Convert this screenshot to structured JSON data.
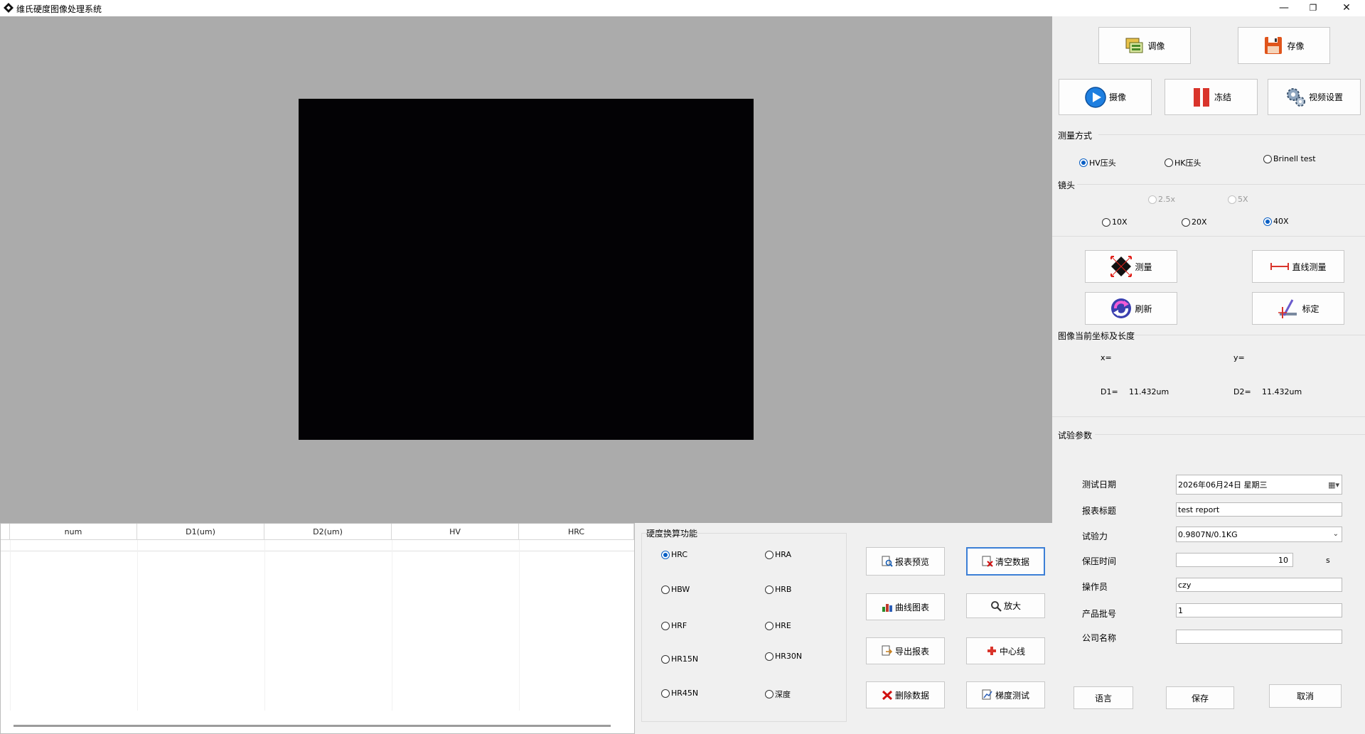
{
  "window": {
    "title": "维氏硬度图像处理系统",
    "minimize": "—",
    "restore": "❐",
    "close": "✕"
  },
  "table": {
    "columns": [
      "num",
      "D1(um)",
      "D2(um)",
      "HV",
      "HRC"
    ]
  },
  "conversion": {
    "title": "硬度换算功能",
    "options": [
      {
        "label": "HRC",
        "checked": true
      },
      {
        "label": "HRA",
        "checked": false
      },
      {
        "label": "HBW",
        "checked": false
      },
      {
        "label": "HRB",
        "checked": false
      },
      {
        "label": "HRF",
        "checked": false
      },
      {
        "label": "HRE",
        "checked": false
      },
      {
        "label": "HR15N",
        "checked": false
      },
      {
        "label": "HR30N",
        "checked": false
      },
      {
        "label": "HR45N",
        "checked": false
      },
      {
        "label": "深度",
        "checked": false
      }
    ]
  },
  "actions": {
    "report_preview": "报表预览",
    "clear_data": "清空数据",
    "curve_chart": "曲线图表",
    "zoom": "放大",
    "export_report": "导出报表",
    "center_line": "中心线",
    "delete_data": "删除数据",
    "gradient_test": "梯度测试"
  },
  "top_buttons": {
    "adjust": "调像",
    "save_image": "存像",
    "capture": "摄像",
    "freeze": "冻结",
    "video_settings": "视频设置"
  },
  "measure_mode": {
    "title": "测量方式",
    "options": [
      {
        "label": "HV压头",
        "checked": true
      },
      {
        "label": "HK压头",
        "checked": false
      },
      {
        "label": "Brinell test",
        "checked": false
      }
    ]
  },
  "lens": {
    "title": "镜头",
    "options": [
      {
        "label": "2.5x",
        "checked": false,
        "disabled": true
      },
      {
        "label": "5X",
        "checked": false,
        "disabled": true
      },
      {
        "label": "10X",
        "checked": false,
        "disabled": false
      },
      {
        "label": "20X",
        "checked": false,
        "disabled": false
      },
      {
        "label": "40X",
        "checked": true,
        "disabled": false
      }
    ]
  },
  "tools": {
    "measure": "测量",
    "line_measure": "直线测量",
    "refresh": "刷新",
    "calibrate": "标定"
  },
  "coords": {
    "title": "图像当前坐标及长度",
    "x_label": "x=",
    "y_label": "y=",
    "d1_label": "D1=",
    "d1_value": "11.432um",
    "d2_label": "D2=",
    "d2_value": "11.432um"
  },
  "params": {
    "title": "试验参数",
    "test_date_label": "测试日期",
    "test_date_value": "2026年06月24日 星期三",
    "report_title_label": "报表标题",
    "report_title_value": "test report",
    "test_force_label": "试验力",
    "test_force_value": "0.9807N/0.1KG",
    "hold_time_label": "保压时间",
    "hold_time_value": "10",
    "hold_time_unit": "s",
    "operator_label": "操作员",
    "operator_value": "czy",
    "batch_label": "产品批号",
    "batch_value": "1",
    "company_label": "公司名称",
    "company_value": ""
  },
  "bottom_buttons": {
    "language": "语言",
    "save": "保存",
    "cancel": "取消"
  },
  "colors": {
    "image_background": "#ababab",
    "video_frame": "#030205",
    "radio_checked": "#0a5fc4",
    "focused_border": "#3c7fd6"
  }
}
